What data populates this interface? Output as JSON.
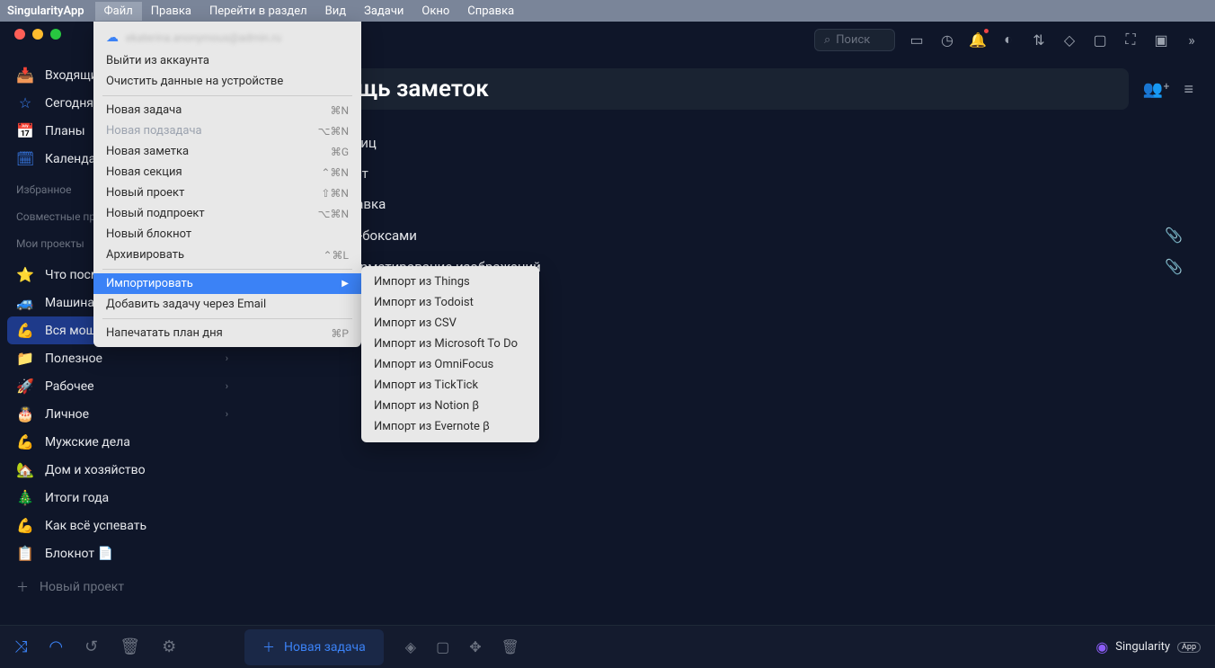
{
  "menubar": {
    "app": "SingularityApp",
    "items": [
      "Файл",
      "Правка",
      "Перейти в раздел",
      "Вид",
      "Задачи",
      "Окно",
      "Справка"
    ],
    "active": 0
  },
  "search": {
    "placeholder": "Поиск"
  },
  "sidebar": {
    "nav": [
      {
        "icon": "inbox",
        "label": "Входящие"
      },
      {
        "icon": "star",
        "label": "Сегодня"
      },
      {
        "icon": "calendar-27",
        "label": "Планы"
      },
      {
        "icon": "calendar-grid",
        "label": "Календарь"
      }
    ],
    "fav_heading": "Избранное",
    "shared_heading": "Совместные проекты",
    "my_heading": "Мои проекты",
    "projects": [
      {
        "emoji": "⭐",
        "label": "Что посмотреть"
      },
      {
        "emoji": "🚙",
        "label": "Машина",
        "chevron": true
      },
      {
        "emoji": "💪",
        "label": "Вся мощь заметок",
        "active": true
      },
      {
        "emoji": "📁",
        "label": "Полезное",
        "chevron": true
      },
      {
        "emoji": "🚀",
        "label": "Рабочее",
        "chevron": true
      },
      {
        "emoji": "🎂",
        "label": "Личное",
        "chevron": true
      },
      {
        "emoji": "💪",
        "label": "Мужские дела"
      },
      {
        "emoji": "🏡",
        "label": "Дом и хозяйство"
      },
      {
        "emoji": "🎄",
        "label": "Итоги года"
      },
      {
        "emoji": "💪",
        "label": "Как всё успевать"
      },
      {
        "emoji": "📋",
        "label": "Блокнот 📄"
      }
    ],
    "add_project": "Новый проект"
  },
  "page": {
    "title": "Вся мощь заметок",
    "lines": [
      "Вставка таблиц",
      "Цветной текст",
      "Быстрая вставка",
      "Список с чек-боксами",
      "Вставка и форматирование изображений"
    ],
    "attachments": [
      false,
      false,
      false,
      true,
      true
    ]
  },
  "file_menu": {
    "account": "ekaterina.anonymous@admin.ru",
    "logout": "Выйти из аккаунта",
    "clear": "Очистить данные на устройстве",
    "items": [
      {
        "label": "Новая задача",
        "shortcut": "⌘N"
      },
      {
        "label": "Новая подзадача",
        "shortcut": "⌥⌘N",
        "disabled": true
      },
      {
        "label": "Новая заметка",
        "shortcut": "⌘G"
      },
      {
        "label": "Новая секция",
        "shortcut": "⌃⌘N"
      },
      {
        "label": "Новый проект",
        "shortcut": "⇧⌘N"
      },
      {
        "label": "Новый подпроект",
        "shortcut": "⌥⌘N"
      },
      {
        "label": "Новый блокнот",
        "shortcut": ""
      },
      {
        "label": "Архивировать",
        "shortcut": "⌃⌘L"
      }
    ],
    "import": "Импортировать",
    "email": "Добавить задачу через Email",
    "print": "Напечатать план дня",
    "print_shortcut": "⌘P"
  },
  "import_submenu": [
    "Импорт из Things",
    "Импорт из Todoist",
    "Импорт из CSV",
    "Импорт из Microsoft To Do",
    "Импорт из OmniFocus",
    "Импорт из TickTick",
    "Импорт из Notion β",
    "Импорт из Evernote β"
  ],
  "bottombar": {
    "new_task": "Новая задача",
    "brand": "Singularity",
    "brand_badge": "App"
  }
}
